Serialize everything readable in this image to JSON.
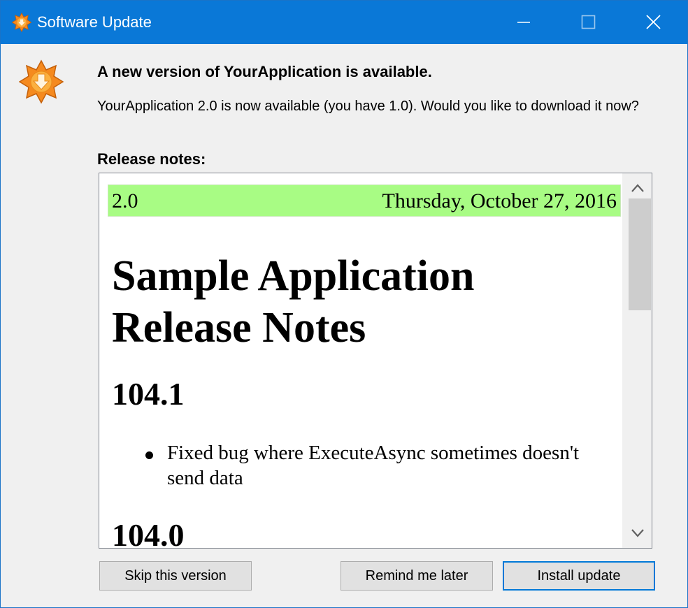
{
  "window": {
    "title": "Software Update",
    "accent_color": "#0a78d7",
    "controls": [
      "minimize-icon",
      "maximize-icon",
      "close-icon"
    ]
  },
  "header": {
    "icon": "update-star-icon",
    "headline": "A new version of YourApplication is available.",
    "description": "YourApplication 2.0 is now available (you have 1.0). Would you like to download it now?"
  },
  "release_notes": {
    "label": "Release notes:",
    "version": "2.0",
    "date": "Thursday, October 27, 2016",
    "version_bar_color": "#a8fc84",
    "heading": "Sample Application Release Notes",
    "sections": [
      {
        "title": "104.1",
        "items": [
          "Fixed bug where ExecuteAsync sometimes doesn't send data"
        ]
      },
      {
        "title": "104.0"
      }
    ]
  },
  "buttons": {
    "skip": "Skip this version",
    "remind": "Remind me later",
    "install": "Install update"
  }
}
